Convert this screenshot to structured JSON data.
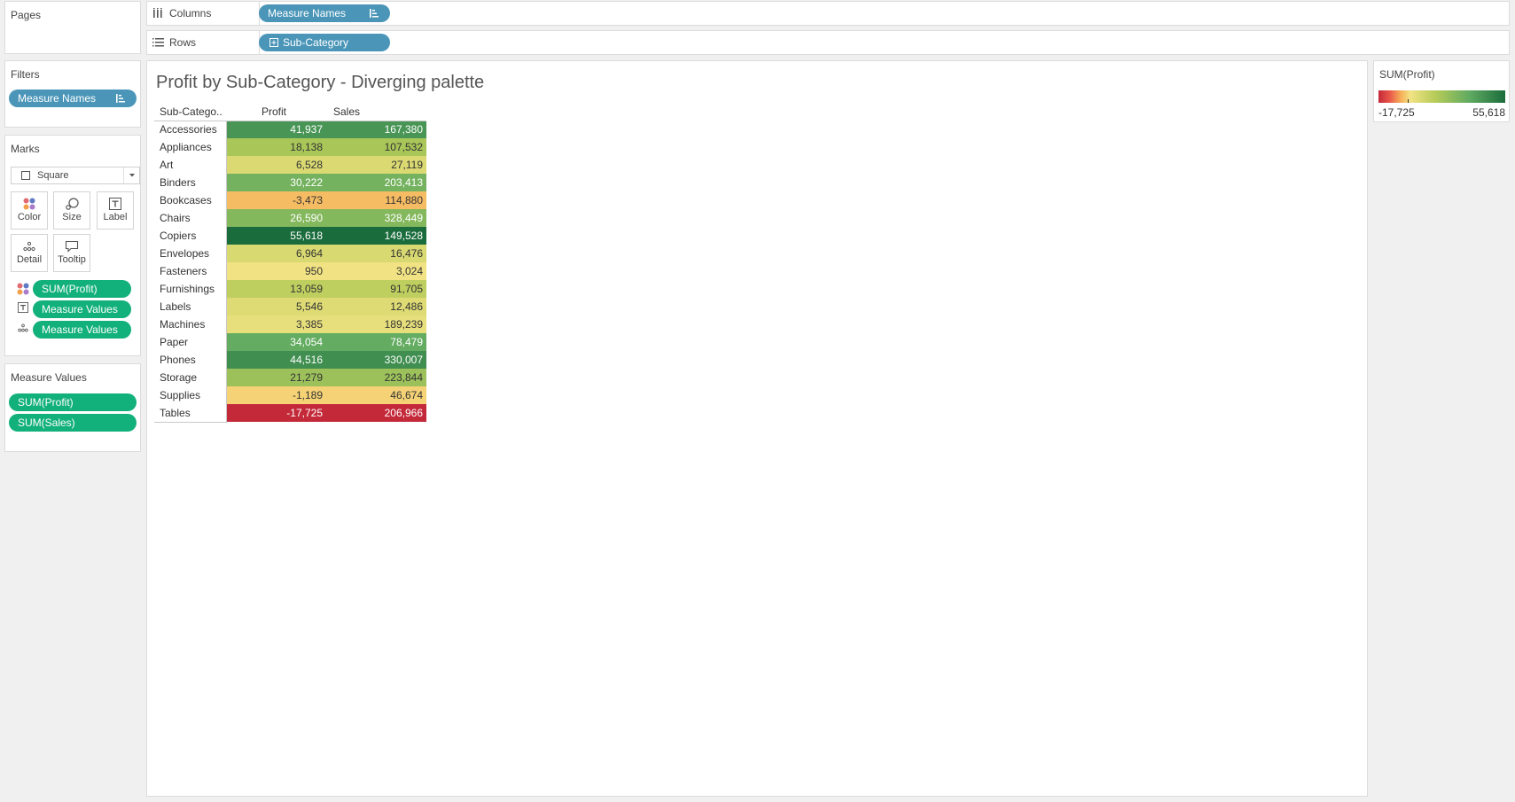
{
  "pages": {
    "title": "Pages"
  },
  "shelves": {
    "columns": {
      "label": "Columns",
      "pill": "Measure Names"
    },
    "rows": {
      "label": "Rows",
      "pill": "Sub-Category"
    }
  },
  "filters": {
    "title": "Filters",
    "items": [
      "Measure Names"
    ]
  },
  "marks": {
    "title": "Marks",
    "mark_type": "Square",
    "buttons": {
      "color": "Color",
      "size": "Size",
      "label": "Label",
      "detail": "Detail",
      "tooltip": "Tooltip"
    },
    "fields": [
      {
        "icon": "color-dots-icon",
        "label": "SUM(Profit)"
      },
      {
        "icon": "text-label-icon",
        "label": "Measure Values"
      },
      {
        "icon": "detail-dots-icon",
        "label": "Measure Values"
      }
    ]
  },
  "measure_values": {
    "title": "Measure Values",
    "items": [
      "SUM(Profit)",
      "SUM(Sales)"
    ]
  },
  "legend": {
    "title": "SUM(Profit)",
    "min": "-17,725",
    "max": "55,618"
  },
  "worksheet": {
    "title": "Profit by Sub-Category - Diverging palette"
  },
  "colors": {
    "pill_blue": "#4b96b8",
    "pill_green": "#12b07b",
    "neg": "#c4293a",
    "mid": "#f2e384",
    "pos": "#1b6c3c"
  },
  "chart_data": {
    "type": "table",
    "title": "Profit by Sub-Category - Diverging palette",
    "columns": [
      "Sub-Catego..",
      "Profit",
      "Sales"
    ],
    "color_measure": "SUM(Profit)",
    "color_range": [
      -17725,
      55618
    ],
    "rows": [
      {
        "sub_category": "Accessories",
        "profit": 41937,
        "sales": 167380,
        "profit_text": "41,937",
        "sales_text": "167,380"
      },
      {
        "sub_category": "Appliances",
        "profit": 18138,
        "sales": 107532,
        "profit_text": "18,138",
        "sales_text": "107,532"
      },
      {
        "sub_category": "Art",
        "profit": 6528,
        "sales": 27119,
        "profit_text": "6,528",
        "sales_text": "27,119"
      },
      {
        "sub_category": "Binders",
        "profit": 30222,
        "sales": 203413,
        "profit_text": "30,222",
        "sales_text": "203,413"
      },
      {
        "sub_category": "Bookcases",
        "profit": -3473,
        "sales": 114880,
        "profit_text": "-3,473",
        "sales_text": "114,880"
      },
      {
        "sub_category": "Chairs",
        "profit": 26590,
        "sales": 328449,
        "profit_text": "26,590",
        "sales_text": "328,449"
      },
      {
        "sub_category": "Copiers",
        "profit": 55618,
        "sales": 149528,
        "profit_text": "55,618",
        "sales_text": "149,528"
      },
      {
        "sub_category": "Envelopes",
        "profit": 6964,
        "sales": 16476,
        "profit_text": "6,964",
        "sales_text": "16,476"
      },
      {
        "sub_category": "Fasteners",
        "profit": 950,
        "sales": 3024,
        "profit_text": "950",
        "sales_text": "3,024"
      },
      {
        "sub_category": "Furnishings",
        "profit": 13059,
        "sales": 91705,
        "profit_text": "13,059",
        "sales_text": "91,705"
      },
      {
        "sub_category": "Labels",
        "profit": 5546,
        "sales": 12486,
        "profit_text": "5,546",
        "sales_text": "12,486"
      },
      {
        "sub_category": "Machines",
        "profit": 3385,
        "sales": 189239,
        "profit_text": "3,385",
        "sales_text": "189,239"
      },
      {
        "sub_category": "Paper",
        "profit": 34054,
        "sales": 78479,
        "profit_text": "34,054",
        "sales_text": "78,479"
      },
      {
        "sub_category": "Phones",
        "profit": 44516,
        "sales": 330007,
        "profit_text": "44,516",
        "sales_text": "330,007"
      },
      {
        "sub_category": "Storage",
        "profit": 21279,
        "sales": 223844,
        "profit_text": "21,279",
        "sales_text": "223,844"
      },
      {
        "sub_category": "Supplies",
        "profit": -1189,
        "sales": 46674,
        "profit_text": "-1,189",
        "sales_text": "46,674"
      },
      {
        "sub_category": "Tables",
        "profit": -17725,
        "sales": 206966,
        "profit_text": "-17,725",
        "sales_text": "206,966"
      }
    ]
  }
}
